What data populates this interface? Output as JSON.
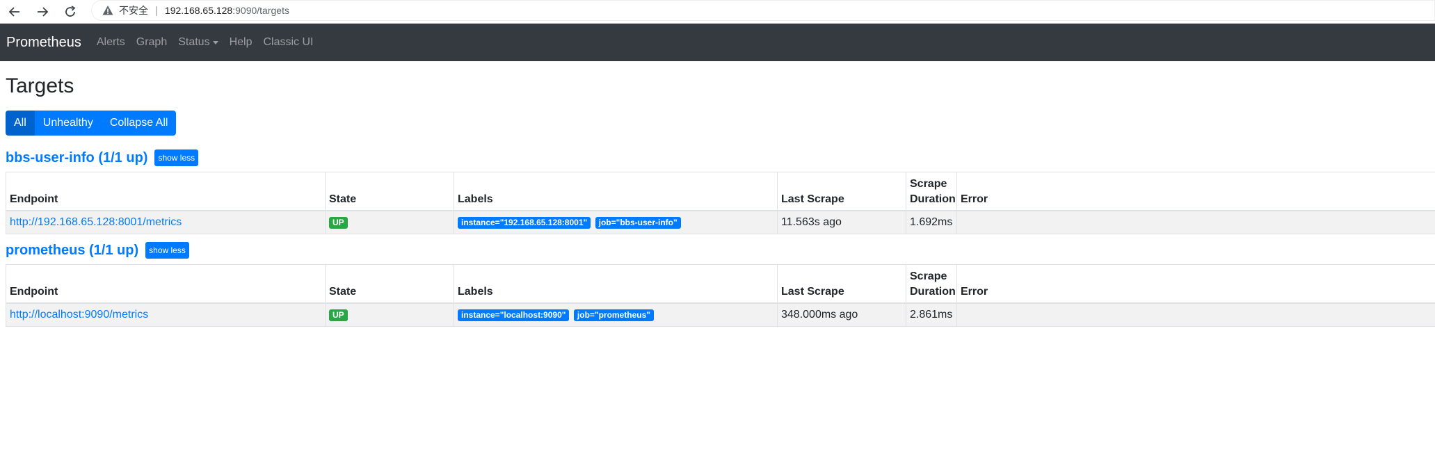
{
  "browser": {
    "insecure_label": "不安全",
    "separator": "|",
    "url_host": "192.168.65.128",
    "url_rest": ":9090/targets"
  },
  "navbar": {
    "brand": "Prometheus",
    "links": [
      "Alerts",
      "Graph",
      "Status",
      "Help",
      "Classic UI"
    ]
  },
  "page": {
    "title": "Targets",
    "filters": [
      "All",
      "Unhealthy",
      "Collapse All"
    ]
  },
  "table_headers": [
    "Endpoint",
    "State",
    "Labels",
    "Last Scrape",
    "Scrape Duration",
    "Error"
  ],
  "jobs": [
    {
      "title": "bbs-user-info (1/1 up)",
      "toggle": "show less",
      "row": {
        "endpoint": "http://192.168.65.128:8001/metrics",
        "state": "UP",
        "labels": [
          "instance=\"192.168.65.128:8001\"",
          "job=\"bbs-user-info\""
        ],
        "last_scrape": "11.563s ago",
        "duration": "1.692ms",
        "error": ""
      }
    },
    {
      "title": "prometheus (1/1 up)",
      "toggle": "show less",
      "row": {
        "endpoint": "http://localhost:9090/metrics",
        "state": "UP",
        "labels": [
          "instance=\"localhost:9090\"",
          "job=\"prometheus\""
        ],
        "last_scrape": "348.000ms ago",
        "duration": "2.861ms",
        "error": ""
      }
    }
  ],
  "colors": {
    "navbar_bg": "#343a40",
    "primary": "#007bff",
    "success": "#28a745"
  }
}
